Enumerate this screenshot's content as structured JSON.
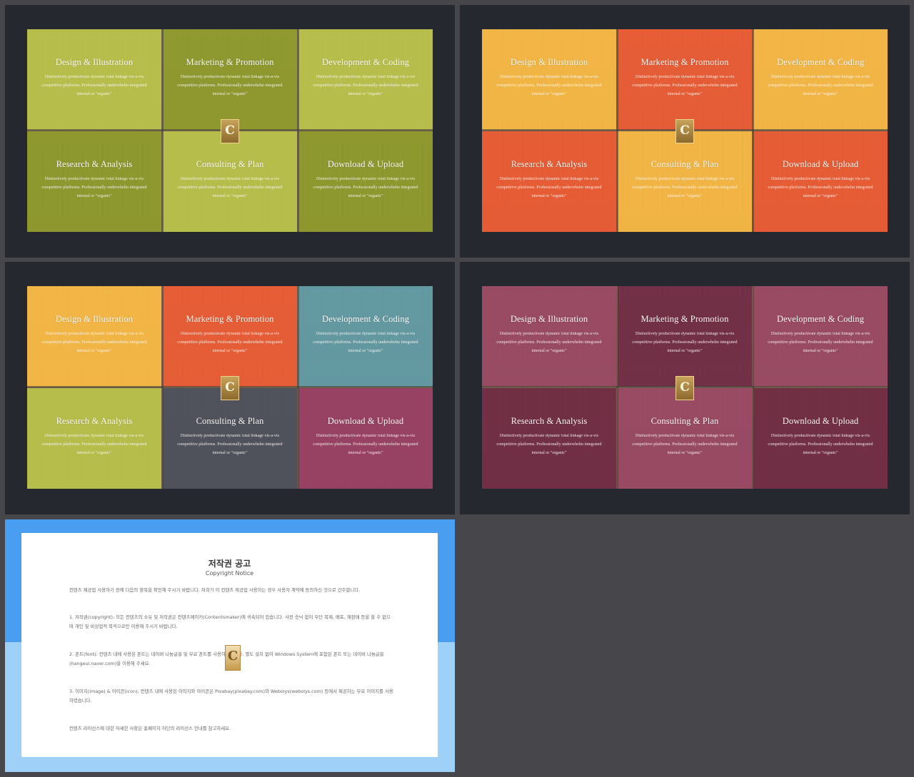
{
  "slides": [
    {
      "panels": [
        {
          "title": "Design & Illustration",
          "desc": "Distinctively productivate dynamic total linkage vis-a-vis competitive platforms. Professionally underwhelm integrated internal or \"organic\"",
          "color": "#b8c24a"
        },
        {
          "title": "Marketing & Promotion",
          "desc": "Distinctively productivate dynamic total linkage vis-a-vis competitive platforms. Professionally underwhelm integrated internal or \"organic\"",
          "color": "#8c9a2c"
        },
        {
          "title": "Development & Coding",
          "desc": "Distinctively productivate dynamic total linkage vis-a-vis competitive platforms. Professionally underwhelm integrated internal or \"organic\"",
          "color": "#b8c24a"
        },
        {
          "title": "Research & Analysis",
          "desc": "Distinctively productivate dynamic total linkage vis-a-vis competitive platforms. Professionally underwhelm integrated internal or \"organic\"",
          "color": "#8c9a2c"
        },
        {
          "title": "Consulting & Plan",
          "desc": "Distinctively productivate dynamic total linkage vis-a-vis competitive platforms. Professionally underwhelm integrated internal or \"organic\"",
          "color": "#b8c24a"
        },
        {
          "title": "Download & Upload",
          "desc": "Distinctively productivate dynamic total linkage vis-a-vis competitive platforms. Professionally underwhelm integrated internal or \"organic\"",
          "color": "#8c9a2c"
        }
      ]
    },
    {
      "panels": [
        {
          "title": "Design & Illustration",
          "desc": "Distinctively productivate dynamic total linkage vis-a-vis competitive platforms. Professionally underwhelm integrated internal or \"organic\"",
          "color": "#f7b944"
        },
        {
          "title": "Marketing & Promotion",
          "desc": "Distinctively productivate dynamic total linkage vis-a-vis competitive platforms. Professionally underwhelm integrated internal or \"organic\"",
          "color": "#ea5a33"
        },
        {
          "title": "Development & Coding",
          "desc": "Distinctively productivate dynamic total linkage vis-a-vis competitive platforms. Professionally underwhelm integrated internal or \"organic\"",
          "color": "#f7b944"
        },
        {
          "title": "Research & Analysis",
          "desc": "Distinctively productivate dynamic total linkage vis-a-vis competitive platforms. Professionally underwhelm integrated internal or \"organic\"",
          "color": "#ea5a33"
        },
        {
          "title": "Consulting & Plan",
          "desc": "Distinctively productivate dynamic total linkage vis-a-vis competitive platforms. Professionally underwhelm integrated internal or \"organic\"",
          "color": "#f7b944"
        },
        {
          "title": "Download & Upload",
          "desc": "Distinctively productivate dynamic total linkage vis-a-vis competitive platforms. Professionally underwhelm integrated internal or \"organic\"",
          "color": "#ea5a33"
        }
      ]
    },
    {
      "panels": [
        {
          "title": "Design & Illustration",
          "desc": "Distinctively productivate dynamic total linkage vis-a-vis competitive platforms. Professionally underwhelm integrated internal or \"organic\"",
          "color": "#f7b944"
        },
        {
          "title": "Marketing & Promotion",
          "desc": "Distinctively productivate dynamic total linkage vis-a-vis competitive platforms. Professionally underwhelm integrated internal or \"organic\"",
          "color": "#ea5a33"
        },
        {
          "title": "Development & Coding",
          "desc": "Distinctively productivate dynamic total linkage vis-a-vis competitive platforms. Professionally underwhelm integrated internal or \"organic\"",
          "color": "#5e9aa6"
        },
        {
          "title": "Research & Analysis",
          "desc": "Distinctively productivate dynamic total linkage vis-a-vis competitive platforms. Professionally underwhelm integrated internal or \"organic\"",
          "color": "#b8c24a"
        },
        {
          "title": "Consulting & Plan",
          "desc": "Distinctively productivate dynamic total linkage vis-a-vis competitive platforms. Professionally underwhelm integrated internal or \"organic\"",
          "color": "#4a4f5c"
        },
        {
          "title": "Download & Upload",
          "desc": "Distinctively productivate dynamic total linkage vis-a-vis competitive platforms. Professionally underwhelm integrated internal or \"organic\"",
          "color": "#973e64"
        }
      ]
    },
    {
      "panels": [
        {
          "title": "Design & Illustration",
          "desc": "Distinctively productivate dynamic total linkage vis-a-vis competitive platforms. Professionally underwhelm integrated internal or \"organic\"",
          "color": "#974763"
        },
        {
          "title": "Marketing & Promotion",
          "desc": "Distinctively productivate dynamic total linkage vis-a-vis competitive platforms. Professionally underwhelm integrated internal or \"organic\"",
          "color": "#6e2a44"
        },
        {
          "title": "Development & Coding",
          "desc": "Distinctively productivate dynamic total linkage vis-a-vis competitive platforms. Professionally underwhelm integrated internal or \"organic\"",
          "color": "#974763"
        },
        {
          "title": "Research & Analysis",
          "desc": "Distinctively productivate dynamic total linkage vis-a-vis competitive platforms. Professionally underwhelm integrated internal or \"organic\"",
          "color": "#6e2a44"
        },
        {
          "title": "Consulting & Plan",
          "desc": "Distinctively productivate dynamic total linkage vis-a-vis competitive platforms. Professionally underwhelm integrated internal or \"organic\"",
          "color": "#974763"
        },
        {
          "title": "Download & Upload",
          "desc": "Distinctively productivate dynamic total linkage vis-a-vis competitive platforms. Professionally underwhelm integrated internal or \"organic\"",
          "color": "#6e2a44"
        }
      ]
    }
  ],
  "emblem": {
    "letter": "C"
  },
  "notice": {
    "title": "저작권 공고",
    "subtitle": "Copyright Notice",
    "paragraphs": [
      "컨텐츠 제공업 사용하기 전에 다음의 항목을 확인해 주시기 바랍니다. 저희가 이 컨텐츠 제공업 사용하는 경우 사용자 계약에 동의하신 것으로 간주합니다.",
      "1. 저작권(copyright): 모든 컨텐츠의 소유 및 저작권은 컨텐츠메이커(Contentsmaker)에 귀속되어 있습니다. 사전 승낙 없이 무단 복제, 배포, 재판매 등을 할 수 없으며 개인 및 비상업적 목적으로만 이용해 주시기 바랍니다.",
      "2. 폰트(font): 컨텐츠 내에 사용된 폰트는 네이버 나눔글꼴 및 무료 폰트를 사용하였습니다. 별도 설치 없이 Windows System에 포함된 폰트 또는 네이버 나눔글꼴(hangeul.naver.com)을 이용해 주세요.",
      "3. 이미지(image) & 아이콘(icon): 컨텐츠 내에 사용된 이미지와 아이콘은 Pixabay(pixabay.com)와 Webolys(webolys.com) 등에서 제공하는 무료 이미지를 사용하였습니다.",
      "컨텐츠 라이선스에 대한 자세한 사항은 홈페이지 하단의 라이선스 안내를 참고하세요."
    ]
  }
}
